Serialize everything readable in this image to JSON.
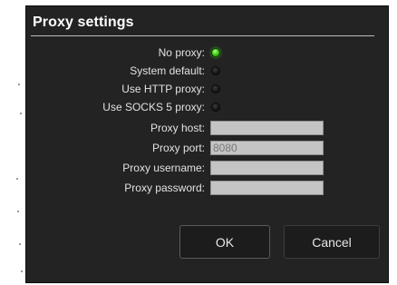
{
  "dialog": {
    "title": "Proxy settings"
  },
  "options": [
    {
      "label": "No proxy:",
      "checked": true
    },
    {
      "label": "System default:",
      "checked": false
    },
    {
      "label": "Use HTTP proxy:",
      "checked": false
    },
    {
      "label": "Use SOCKS 5 proxy:",
      "checked": false
    }
  ],
  "fields": {
    "host": {
      "label": "Proxy host:",
      "value": ""
    },
    "port": {
      "label": "Proxy port:",
      "value": "8080"
    },
    "username": {
      "label": "Proxy username:",
      "value": ""
    },
    "password": {
      "label": "Proxy password:",
      "value": ""
    }
  },
  "buttons": {
    "ok_label": "OK",
    "cancel_label": "Cancel"
  },
  "colors": {
    "dialog_bg": "#232323",
    "radio_checked": "#48d41c",
    "field_bg": "#c4c4c4"
  }
}
